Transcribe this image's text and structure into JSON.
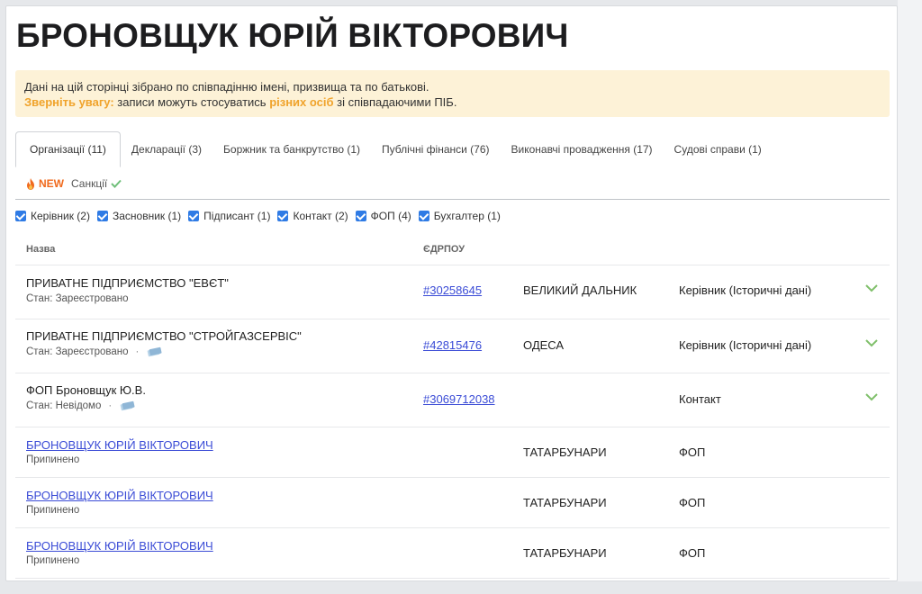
{
  "title": "БРОНОВЩУК ЮРІЙ ВІКТОРОВИЧ",
  "notice": {
    "line1": "Дані на цій сторінці зібрано по співпадінню імені, призвища та по батькові.",
    "warn": "Зверніть увагу:",
    "mid": " записи можуть стосуватись ",
    "highlight": "різних осіб",
    "end": " зі співпадаючими ПІБ."
  },
  "tabs": [
    {
      "label": "Організації (11)",
      "active": true
    },
    {
      "label": "Декларації (3)"
    },
    {
      "label": "Боржник та банкрутство (1)"
    },
    {
      "label": "Публічні фінанси (76)"
    },
    {
      "label": "Виконавчі провадження (17)"
    },
    {
      "label": "Судові справи (1)"
    }
  ],
  "tab_new": {
    "badge": "NEW",
    "label": "Санкції"
  },
  "filters": [
    {
      "label": "Керівник (2)"
    },
    {
      "label": "Засновник (1)"
    },
    {
      "label": "Підписант (1)"
    },
    {
      "label": "Контакт (2)"
    },
    {
      "label": "ФОП (4)"
    },
    {
      "label": "Бухгалтер (1)"
    }
  ],
  "table": {
    "headers": {
      "name": "Назва",
      "edrpou": "ЄДРПОУ"
    },
    "rows": [
      {
        "name": "ПРИВАТНЕ ПІДПРИЄМСТВО \"ЕВЄТ\"",
        "status": "Стан: Зареєстровано",
        "code": "#30258645",
        "city": "ВЕЛИКИЙ ДАЛЬНИК",
        "role": "Керівник (Історичні дані)"
      },
      {
        "name": "ПРИВАТНЕ ПІДПРИЄМСТВО \"СТРОЙГАЗСЕРВІС\"",
        "status": "Стан: Зареєстровано",
        "code": "#42815476",
        "city": "ОДЕСА",
        "role": "Керівник (Історичні дані)"
      },
      {
        "name": "ФОП Броновщук Ю.В.",
        "status": "Стан: Невідомо",
        "code": "#3069712038",
        "city": "",
        "role": "Контакт"
      },
      {
        "name": "БРОНОВЩУК ЮРІЙ ВІКТОРОВИЧ",
        "status": "Припинено",
        "code": "",
        "city": "ТАТАРБУНАРИ",
        "role": "ФОП"
      },
      {
        "name": "БРОНОВЩУК ЮРІЙ ВІКТОРОВИЧ",
        "status": "Припинено",
        "code": "",
        "city": "ТАТАРБУНАРИ",
        "role": "ФОП"
      },
      {
        "name": "БРОНОВЩУК ЮРІЙ ВІКТОРОВИЧ",
        "status": "Припинено",
        "code": "",
        "city": "ТАТАРБУНАРИ",
        "role": "ФОП"
      }
    ]
  }
}
